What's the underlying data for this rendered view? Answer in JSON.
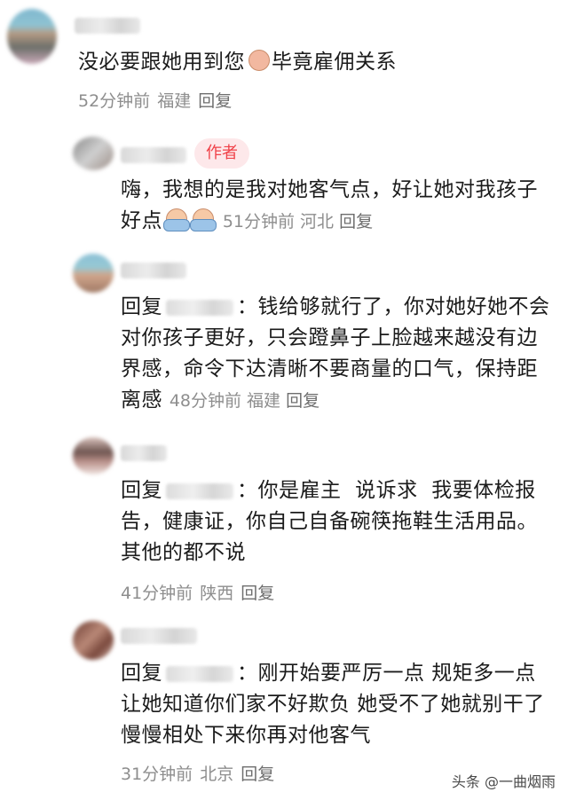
{
  "comments": [
    {
      "text_before_emoji": "没必要跟她用到您",
      "emoji": "doge-face-icon",
      "text_after_emoji": "毕竟雇佣关系",
      "time": "52分钟前",
      "location": "福建",
      "reply_label": "回复"
    },
    {
      "badge": "作者",
      "text": "嗨，我想的是我对她客气点，好让她对我孩子好点",
      "emoji": "praying-hands-icon",
      "time": "51分钟前",
      "location": "河北",
      "reply_label": "回复"
    },
    {
      "reply_prefix": "回复",
      "text": "：钱给够就行了，你对她好她不会对你孩子更好，只会蹬鼻子上脸越来越没有边界感，命令下达清晰不要商量的口气，保持距离感",
      "time": "48分钟前",
      "location": "福建",
      "reply_label": "回复"
    },
    {
      "reply_prefix": "回复",
      "text": "：你是雇主  说诉求  我要体检报告，健康证，你自己自备碗筷拖鞋生活用品。其他的都不说",
      "time": "41分钟前",
      "location": "陕西",
      "reply_label": "回复"
    },
    {
      "reply_prefix": "回复",
      "text": "：刚开始要严厉一点 规矩多一点 让她知道你们家不好欺负 她受不了她就别干了 慢慢相处下来你再对他客气",
      "time": "31分钟前",
      "location": "北京",
      "reply_label": "回复"
    }
  ],
  "watermark": "头条 @一曲烟雨",
  "colors": {
    "badge_bg": "#fde8ea",
    "badge_text": "#f04148",
    "meta_text": "#8e8e8e"
  }
}
